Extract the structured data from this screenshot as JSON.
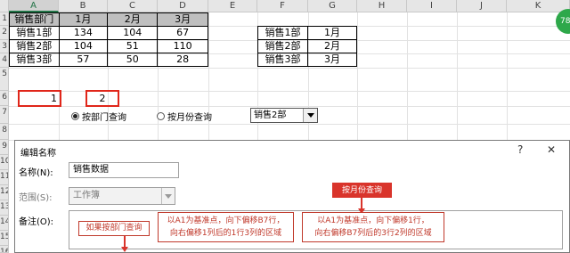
{
  "sheet": {
    "columns": [
      "A",
      "B",
      "C",
      "D",
      "E",
      "F",
      "G",
      "H",
      "I",
      "J",
      "K"
    ],
    "rows": [
      "1",
      "2",
      "3",
      "4",
      "5",
      "6",
      "7",
      "8",
      "9",
      "10",
      "11",
      "12",
      "13",
      "14",
      "15",
      "16"
    ],
    "table1": {
      "header": [
        "销售部门",
        "1月",
        "2月",
        "3月"
      ],
      "rows": [
        [
          "销售1部",
          "134",
          "104",
          "67"
        ],
        [
          "销售2部",
          "104",
          "51",
          "110"
        ],
        [
          "销售3部",
          "57",
          "50",
          "28"
        ]
      ]
    },
    "table2": [
      [
        "销售1部",
        "1月"
      ],
      [
        "销售2部",
        "2月"
      ],
      [
        "销售3部",
        "3月"
      ]
    ],
    "cell_a6": "1",
    "cell_c6": "2",
    "radio1": "按部门查询",
    "radio2": "按月份查询",
    "combo_value": "销售2部",
    "badge": "78"
  },
  "dialog": {
    "title": "编辑名称",
    "help": "?",
    "close": "✕",
    "name_label": "名称(N):",
    "name_value": "销售数据",
    "scope_label": "范围(S):",
    "scope_value": "工作簿",
    "comment_label": "备注(O):"
  },
  "callouts": {
    "by_month": "按月份查询",
    "by_dept": "如果按部门查询",
    "dept_explain_1": "以A1为基准点，向下偏移B7行，",
    "dept_explain_2": "向右偏移1列后的1行3列的区域",
    "month_explain_1": "以A1为基准点，向下偏移1行，",
    "month_explain_2": "向右偏移B7列后的3行2列的区域"
  }
}
